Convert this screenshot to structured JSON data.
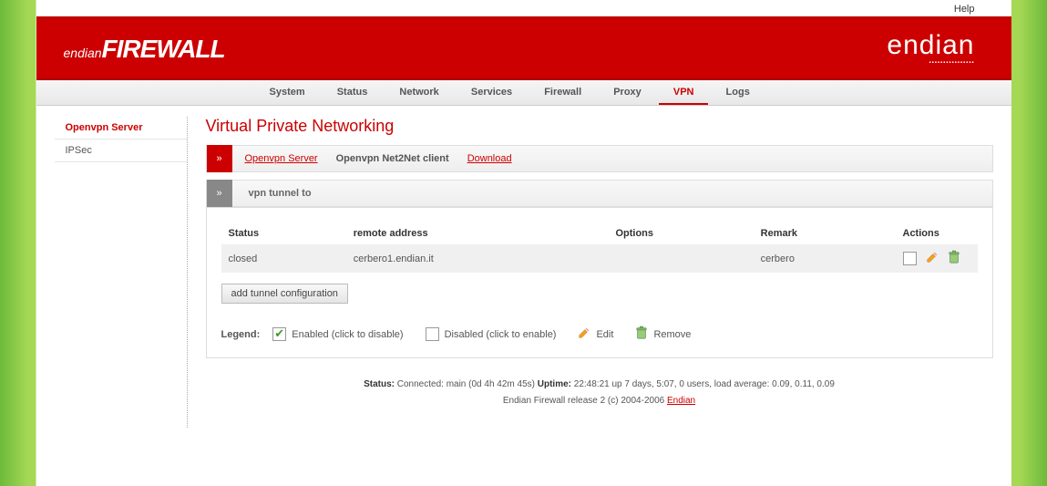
{
  "help": "Help",
  "logo": {
    "prefix": "endian",
    "main": "FIREWALL",
    "right": "endian"
  },
  "nav": {
    "items": [
      {
        "label": "System"
      },
      {
        "label": "Status"
      },
      {
        "label": "Network"
      },
      {
        "label": "Services"
      },
      {
        "label": "Firewall"
      },
      {
        "label": "Proxy"
      },
      {
        "label": "VPN"
      },
      {
        "label": "Logs"
      }
    ],
    "active": "VPN"
  },
  "sidebar": {
    "items": [
      {
        "label": "Openvpn Server",
        "active": true
      },
      {
        "label": "IPSec",
        "active": false
      }
    ]
  },
  "page_title": "Virtual Private Networking",
  "subtabs": {
    "arrow": "»",
    "items": [
      {
        "label": "Openvpn Server",
        "kind": "link"
      },
      {
        "label": "Openvpn Net2Net client",
        "kind": "selected"
      },
      {
        "label": "Download",
        "kind": "link"
      }
    ]
  },
  "section_bar": {
    "arrow": "»",
    "label": "vpn tunnel to"
  },
  "table": {
    "headers": [
      "Status",
      "remote address",
      "Options",
      "Remark",
      "Actions"
    ],
    "rows": [
      {
        "status": "closed",
        "remote": "cerbero1.endian.it",
        "options": "",
        "remark": "cerbero"
      }
    ]
  },
  "add_button": "add tunnel configuration",
  "legend": {
    "title": "Legend:",
    "enabled": "Enabled (click to disable)",
    "disabled": "Disabled (click to enable)",
    "edit": "Edit",
    "remove": "Remove"
  },
  "footer": {
    "status_label": "Status:",
    "status_text": "Connected: main (0d 4h 42m 45s)",
    "uptime_label": "Uptime:",
    "uptime_text": "22:48:21 up 7 days, 5:07, 0 users, load average: 0.09, 0.11, 0.09",
    "release": "Endian Firewall release 2 (c) 2004-2006 ",
    "link": "Endian"
  }
}
